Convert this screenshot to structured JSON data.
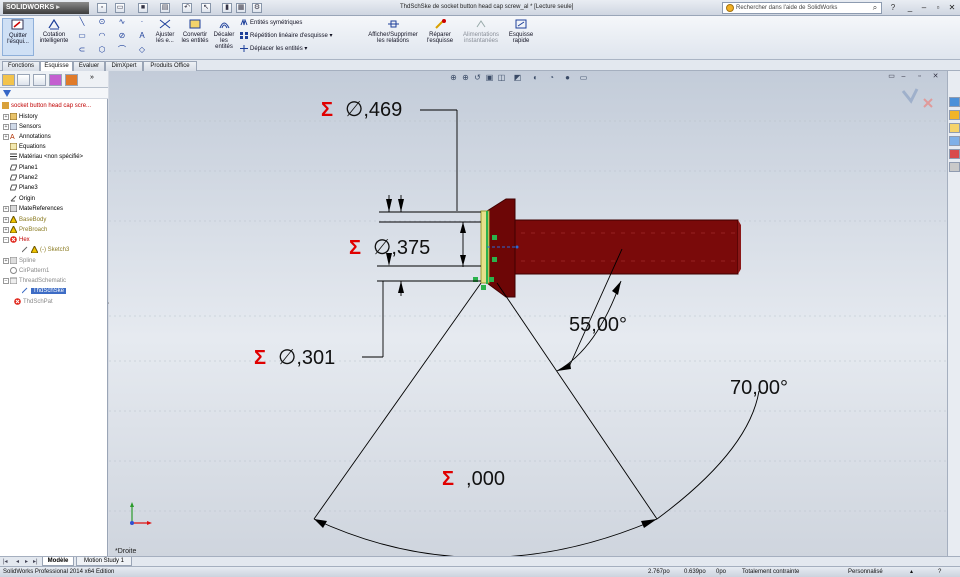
{
  "app": {
    "logo_text": "SOLIDWORKS",
    "document_title": "ThdSchSke de socket button head cap screw_al * [Lecture seule]",
    "search_placeholder": "Rechercher dans l'aide de SolidWorks"
  },
  "ribbon": {
    "quit_sketch_label": "Quitter l'esqui...",
    "smart_dimension_label": "Cotation intelligente",
    "trim_label": "Ajuster les e...",
    "convert_label": "Convertir les entités",
    "offset_label": "Décaler les entités",
    "mirror_label": "Entités symétriques",
    "linear_pattern_label": "Répétition linéaire d'esquisse",
    "move_label": "Déplacer les entités",
    "display_relations_label": "Afficher/Supprimer les relations",
    "repair_label": "Réparer l'esquisse",
    "quick_snaps_label": "Alimentations instantanées",
    "rapid_sketch_label": "Esquisse rapide"
  },
  "command_tabs": [
    "Fonctions",
    "Esquisse",
    "Evaluer",
    "DimXpert",
    "Produits Office"
  ],
  "tree": {
    "root": "socket button head cap scre...",
    "items": [
      "History",
      "Sensors",
      "Annotations",
      "Equations",
      "Matériau <non spécifié>",
      "Plane1",
      "Plane2",
      "Plane3",
      "Origin",
      "MateReferences",
      "BaseBody",
      "PreBroach",
      "Hex",
      "(-) Sketch3",
      "Spline",
      "CirPattern1",
      "ThreadSchematic",
      "ThdSchSke",
      "ThdSchPat"
    ]
  },
  "viewport": {
    "view_orientation": "*Droite",
    "dimensions": {
      "d1_prefix": "Σ",
      "d1_symbol": "∅",
      "d1_value": ",469",
      "d2_prefix": "Σ",
      "d2_symbol": "∅",
      "d2_value": ",375",
      "d3_prefix": "Σ",
      "d3_symbol": "∅",
      "d3_value": ",301",
      "angle1": "55,00°",
      "angle2": "70,00°",
      "d4_prefix": "Σ",
      "d4_value": ",000"
    },
    "colors": {
      "body": "#7a0a0a",
      "dimension_sigma": "#e00000",
      "selection": "#2bb24c"
    }
  },
  "bottom_tabs": [
    "Modèle",
    "Motion Study 1"
  ],
  "status": {
    "edition": "SolidWorks Professional 2014 x64 Edition",
    "x": "2.767po",
    "y": "0.639po",
    "z": "0po",
    "state": "Totalement contrainte",
    "units": "Personnalisé"
  }
}
